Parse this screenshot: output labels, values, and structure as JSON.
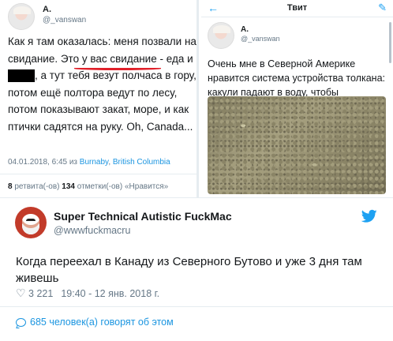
{
  "left_tweet": {
    "name": "A.",
    "handle": "@_vanswan",
    "text_parts": {
      "p1": "Как я там оказалась: меня позвали на свидание. Это у вас свидание - еда и ",
      "p2": ", а тут тебя везут полчаса в гору, потом ещё полтора ведут по лесу, потом показывают закат, море, и как птички садятся на руку. Oh, Canada..."
    },
    "meta_time": "04.01.2018, 6:45 из ",
    "meta_place1": "Burnaby",
    "meta_sep": ", ",
    "meta_place2": "British Columbia",
    "retweets_count": "8",
    "retweets_label": " ретвита(-ов) ",
    "likes_count": "134",
    "likes_label": " отметки(-ов) «Нравится»"
  },
  "right_tweet": {
    "back": "←",
    "title": "Твит",
    "compose": "✎",
    "name": "A.",
    "handle": "@_vanswan",
    "text": "Очень мне в Северной Америке нравится система устройства толкана: какули падают в воду, чтобы"
  },
  "main_tweet": {
    "name": "Super Technical Autistic FuckMac",
    "handle": "@wwwfuckmacru",
    "text": "Когда переехал в Канаду из Северного Бутово и уже 3 дня там живешь",
    "likes": "3 221",
    "timestamp": "19:40 - 12 янв. 2018 г.",
    "talking": "685 человек(а) говорят об этом"
  },
  "colors": {
    "link": "#1b95e0",
    "underline": "#e0202a",
    "muted": "#657786"
  },
  "icons": {
    "like": "heart-icon",
    "logo": "twitter-bird-icon",
    "reply": "speech-bubble-icon"
  }
}
